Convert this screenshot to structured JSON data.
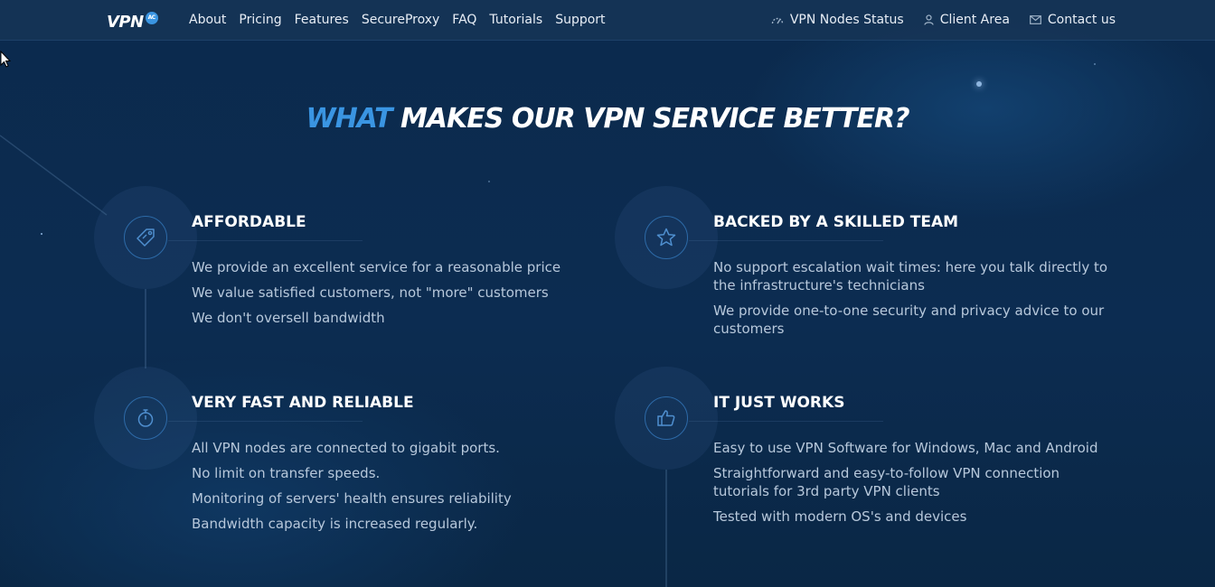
{
  "header": {
    "logo_text": "VPN",
    "logo_badge": "AC",
    "nav": [
      "About",
      "Pricing",
      "Features",
      "SecureProxy",
      "FAQ",
      "Tutorials",
      "Support"
    ],
    "right_nav": {
      "status": "VPN Nodes Status",
      "client": "Client Area",
      "contact": "Contact us"
    }
  },
  "hero": {
    "heading_accent": "WHAT",
    "heading_rest": "MAKES OUR VPN SERVICE BETTER?"
  },
  "features": [
    {
      "icon": "price-tag-icon",
      "title": "AFFORDABLE",
      "items": [
        "We provide an excellent service for a reasonable price",
        "We value satisfied customers, not \"more\" customers",
        "We don't oversell bandwidth"
      ]
    },
    {
      "icon": "star-icon",
      "title": "BACKED BY A SKILLED TEAM",
      "items": [
        "No support escalation wait times: here you talk directly to the infrastructure's technicians",
        "We provide one-to-one security and privacy advice to our customers"
      ]
    },
    {
      "icon": "stopwatch-icon",
      "title": "VERY FAST AND RELIABLE",
      "items": [
        "All VPN nodes are connected to gigabit ports.",
        "No limit on transfer speeds.",
        "Monitoring of servers' health ensures reliability",
        "Bandwidth capacity is increased regularly."
      ]
    },
    {
      "icon": "thumbs-up-icon",
      "title": "IT JUST WORKS",
      "items": [
        "Easy to use VPN Software for Windows, Mac and Android",
        "Straightforward and easy-to-follow VPN connection tutorials for 3rd party VPN clients",
        "Tested with modern OS's and devices"
      ]
    }
  ],
  "colors": {
    "background": "#0c2b4f",
    "accent": "#3a95e2",
    "body_text": "#b7c8db"
  }
}
